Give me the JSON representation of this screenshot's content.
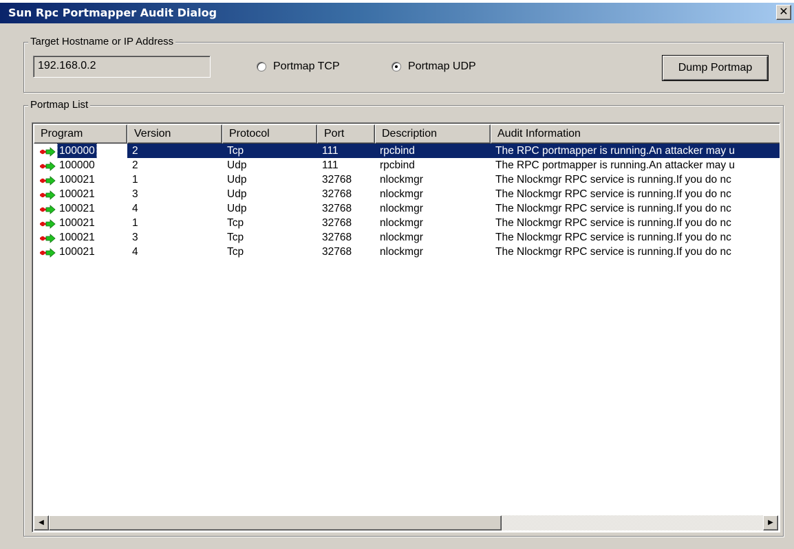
{
  "window": {
    "title": "Sun Rpc Portmapper Audit Dialog",
    "close_glyph": "✕"
  },
  "target": {
    "group_label": "Target Hostname or IP Address",
    "host_value": "192.168.0.2",
    "radio_tcp_label": "Portmap TCP",
    "radio_udp_label": "Portmap UDP",
    "selected_protocol": "udp",
    "dump_button": "Dump Portmap"
  },
  "list": {
    "group_label": "Portmap List",
    "columns": [
      "Program",
      "Version",
      "Protocol",
      "Port",
      "Description",
      "Audit Information"
    ],
    "rows": [
      {
        "program": "100000",
        "version": "2",
        "protocol": "Tcp",
        "port": "111",
        "description": "rpcbind",
        "audit": "The RPC portmapper is running.An attacker may u",
        "selected": true
      },
      {
        "program": "100000",
        "version": "2",
        "protocol": "Udp",
        "port": "111",
        "description": "rpcbind",
        "audit": "The RPC portmapper is running.An attacker may u"
      },
      {
        "program": "100021",
        "version": "1",
        "protocol": "Udp",
        "port": "32768",
        "description": "nlockmgr",
        "audit": "The Nlockmgr RPC service is running.If you do nc"
      },
      {
        "program": "100021",
        "version": "3",
        "protocol": "Udp",
        "port": "32768",
        "description": "nlockmgr",
        "audit": "The Nlockmgr RPC service is running.If you do nc"
      },
      {
        "program": "100021",
        "version": "4",
        "protocol": "Udp",
        "port": "32768",
        "description": "nlockmgr",
        "audit": "The Nlockmgr RPC service is running.If you do nc"
      },
      {
        "program": "100021",
        "version": "1",
        "protocol": "Tcp",
        "port": "32768",
        "description": "nlockmgr",
        "audit": "The Nlockmgr RPC service is running.If you do nc"
      },
      {
        "program": "100021",
        "version": "3",
        "protocol": "Tcp",
        "port": "32768",
        "description": "nlockmgr",
        "audit": "The Nlockmgr RPC service is running.If you do nc"
      },
      {
        "program": "100021",
        "version": "4",
        "protocol": "Tcp",
        "port": "32768",
        "description": "nlockmgr",
        "audit": "The Nlockmgr RPC service is running.If you do nc"
      }
    ],
    "row_icon": "red-green-arrow-icon",
    "scrollbar": {
      "left_glyph": "◀",
      "right_glyph": "▶"
    }
  },
  "colors": {
    "selection": "#0a246a",
    "dialog_bg": "#d4d0c8",
    "title_start": "#0a246a",
    "title_end": "#a6caf0"
  }
}
